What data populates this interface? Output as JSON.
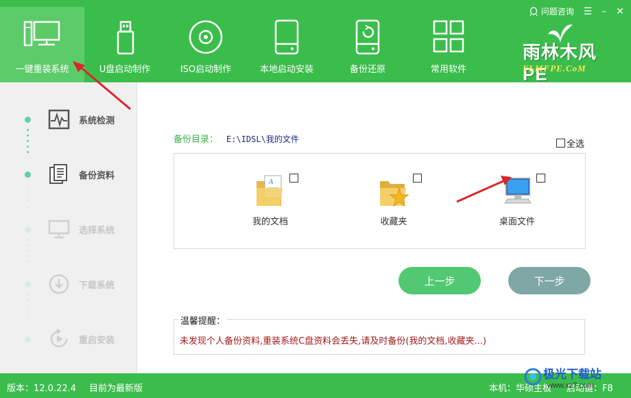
{
  "header": {
    "help_label": "问题咨询",
    "nav": [
      {
        "label": "一键重装系统",
        "icon": "desktop-computer-icon",
        "active": true
      },
      {
        "label": "U盘启动制作",
        "icon": "usb-drive-icon",
        "active": false
      },
      {
        "label": "ISO启动制作",
        "icon": "disc-icon",
        "active": false
      },
      {
        "label": "本地启动安装",
        "icon": "hard-drive-icon",
        "active": false
      },
      {
        "label": "备份还原",
        "icon": "backup-restore-icon",
        "active": false
      },
      {
        "label": "常用软件",
        "icon": "apps-grid-icon",
        "active": false
      }
    ],
    "logo_text": "雨林木风PE",
    "logo_url": "YLMFPE.CoM"
  },
  "sidebar": {
    "steps": [
      {
        "label": "系统检测",
        "icon": "pulse-monitor-icon",
        "state": "done"
      },
      {
        "label": "备份资料",
        "icon": "documents-icon",
        "state": "current"
      },
      {
        "label": "选择系统",
        "icon": "monitor-icon",
        "state": "pending"
      },
      {
        "label": "下载系统",
        "icon": "download-icon",
        "state": "pending"
      },
      {
        "label": "重启安装",
        "icon": "restart-icon",
        "state": "pending"
      }
    ]
  },
  "main": {
    "backup_dir_label": "备份目录：",
    "backup_dir_path": "E:\\IDSL\\我的文件",
    "select_all_label": "全选",
    "folders": [
      {
        "label": "我的文档",
        "icon": "documents-folder-icon"
      },
      {
        "label": "收藏夹",
        "icon": "favorites-folder-icon"
      },
      {
        "label": "桌面文件",
        "icon": "desktop-files-icon"
      }
    ],
    "prev_button": "上一步",
    "next_button": "下一步",
    "tips_title": "温馨提醒：",
    "tips_text": "未发现个人备份资料,重装系统C盘资料会丢失,请及时备份(我的文档,收藏夹...)"
  },
  "footer": {
    "version": "版本：12.0.22.4",
    "status": "目前为最新版",
    "board": "本机：华硕主板",
    "hotkey": "启动键：F8"
  },
  "watermark": {
    "title": "极光下载站",
    "url": "www.xz7.com"
  },
  "colors": {
    "brand_green": "#3bbd4c",
    "active_tab": "#5ccb69",
    "prev_button": "#52c872",
    "next_button": "#7fa7a6",
    "tip_red": "#a11a1a"
  }
}
